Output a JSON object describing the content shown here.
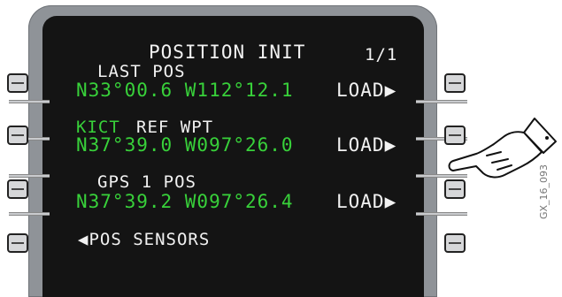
{
  "title": "POSITION INIT",
  "page_indicator": "1/1",
  "rows": [
    {
      "label": "LAST POS",
      "value": "N33°00.6 W112°12.1",
      "action": "LOAD"
    },
    {
      "label_green": "KICT",
      "label": "REF WPT",
      "value": "N37°39.0 W097°26.0",
      "action": "LOAD"
    },
    {
      "label": "GPS 1 POS",
      "value": "N37°39.2 W097°26.4",
      "action": "LOAD"
    }
  ],
  "bottom_left": "POS SENSORS",
  "arrow_right": "▶",
  "arrow_left": "◀",
  "figure_id": "GX_16_093",
  "colors": {
    "text": "#f2f2f2",
    "data": "#38d13a",
    "screen": "#141414",
    "bezel": "#8f9398"
  },
  "icons": [
    "pointing-hand-icon"
  ]
}
